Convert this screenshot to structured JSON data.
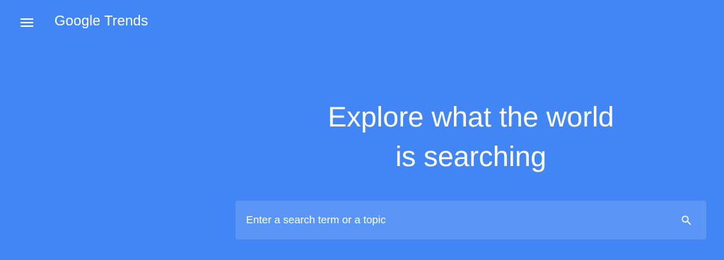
{
  "header": {
    "menu_icon": "hamburger-menu-icon",
    "logo_brand": "Google",
    "logo_product": "Trends"
  },
  "hero": {
    "line1": "Explore what the world",
    "line2": "is searching"
  },
  "search": {
    "placeholder": "Enter a search term or a topic",
    "value": "",
    "icon": "search-icon"
  },
  "colors": {
    "background": "#4285f4",
    "search_box": "#5b96f6",
    "text": "#ffffff"
  }
}
